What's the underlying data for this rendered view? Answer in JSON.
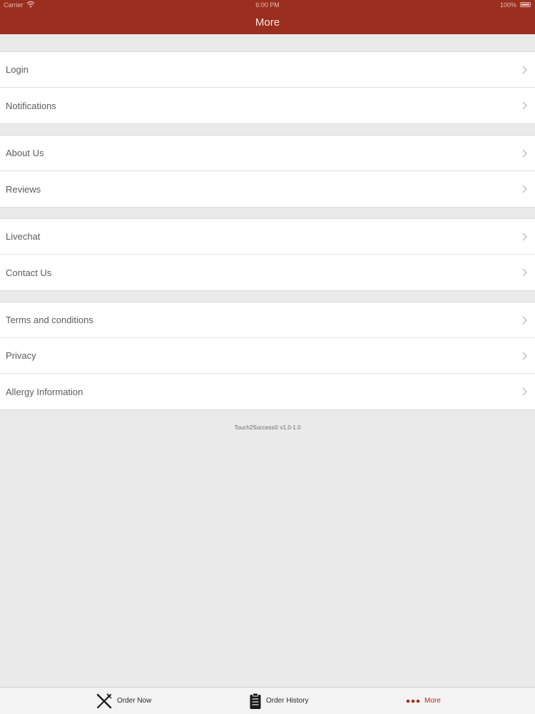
{
  "status_bar": {
    "carrier": "Carrier",
    "time": "6:00 PM",
    "battery_percent": "100%",
    "battery_level": 1.0,
    "wifi_icon": "wifi-icon",
    "battery_icon": "battery-icon"
  },
  "nav": {
    "title": "More"
  },
  "groups": [
    {
      "items": [
        {
          "label": "Login"
        },
        {
          "label": "Notifications"
        }
      ]
    },
    {
      "items": [
        {
          "label": "About Us"
        },
        {
          "label": "Reviews"
        }
      ]
    },
    {
      "items": [
        {
          "label": "Livechat"
        },
        {
          "label": "Contact Us"
        }
      ]
    },
    {
      "items": [
        {
          "label": "Terms and conditions"
        },
        {
          "label": "Privacy"
        },
        {
          "label": "Allergy Information"
        }
      ]
    }
  ],
  "footer": {
    "version_text": "Touch2Success© v1.0-1.0"
  },
  "tab_bar": {
    "tabs": [
      {
        "label": "Order Now",
        "icon": "fork-knife-icon"
      },
      {
        "label": "Order History",
        "icon": "clipboard-icon"
      },
      {
        "label": "More",
        "icon": "more-dots-icon",
        "active": true
      }
    ]
  },
  "colors": {
    "nav_background": "#9a2f1f",
    "active_tab": "#a9301d",
    "page_background": "#ebeaeb"
  }
}
